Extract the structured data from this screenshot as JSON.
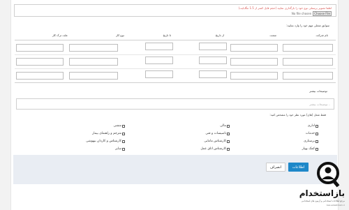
{
  "upload": {
    "note": "لطفا تصویر پرسنلی نوع خود را بارگذاری نمایید (حجم فایل کمتر از 1.5 مگابایت)",
    "button_label": "Choose File",
    "no_file_text": "No file chosen"
  },
  "work_history": {
    "title": "سوابق شغلی مهم خود را وارد نمایید:",
    "columns": [
      "نام شرکت",
      "سمت",
      "از تاریخ",
      "تا تاریخ",
      "نوع کار",
      "علت ترک کار"
    ]
  },
  "description": {
    "label": "توضیحات بیشتر",
    "placeholder": "توضیحات بیشتر..."
  },
  "job_fields": {
    "title": "فقط شغل (های) مورد نظر خود را مشخص کنید:",
    "options": [
      [
        "اداری",
        "مالی",
        "منشی"
      ],
      [
        "خدمات",
        "تاسیسات و فنی",
        "مترجم و راهنمای بیمار"
      ],
      [
        "پرستاری",
        "کارشناس مامایی",
        "کارشناس و کاردان بیهوشی"
      ],
      [
        "کمک بهیار",
        "کارشناس اتاق عمل",
        "سایر"
      ]
    ]
  },
  "actions": {
    "submit_label": "اطلاعات",
    "cancel_label": "انصراف"
  },
  "brand": {
    "name": "بازاستخدام",
    "tagline": "مرجع اطلاعات استخدامی و آزمون های استخدامی",
    "url": "baz-estekhdam.ir",
    "accent": "#1e88c9"
  }
}
